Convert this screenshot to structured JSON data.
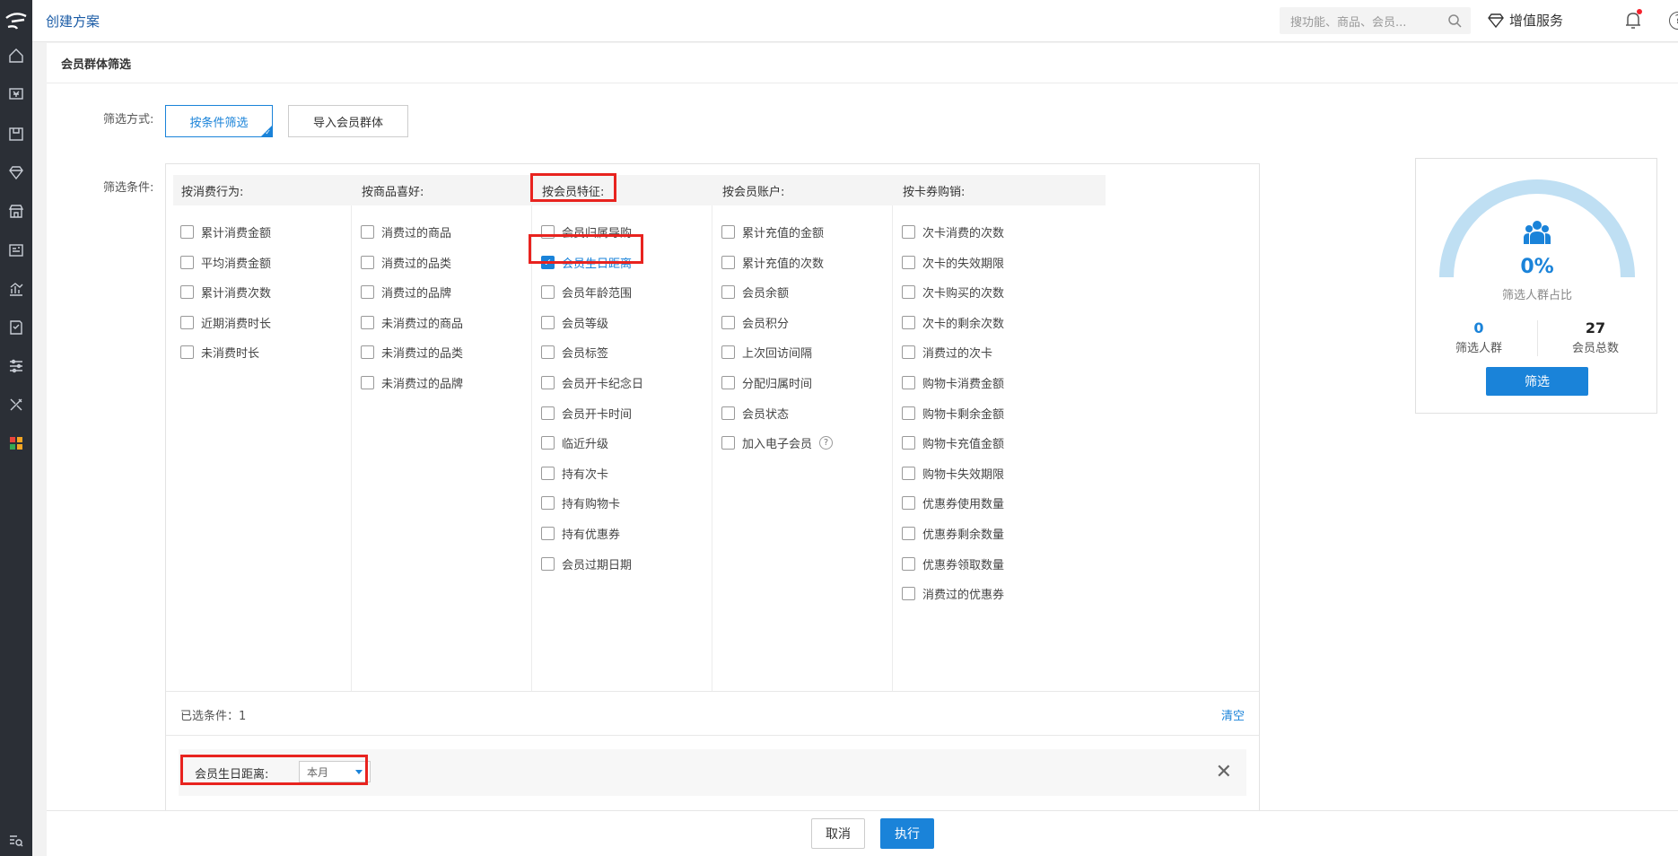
{
  "app": {
    "title": "创建方案"
  },
  "search": {
    "placeholder": "搜功能、商品、会员..."
  },
  "header": {
    "value_service": "增值服务"
  },
  "section": {
    "title": "会员群体筛选"
  },
  "filter_mode": {
    "label": "筛选方式:",
    "options": [
      "按条件筛选",
      "导入会员群体"
    ],
    "active": "按条件筛选"
  },
  "conditions": {
    "label": "筛选条件:",
    "columns": [
      {
        "title": "按消费行为:",
        "items": [
          "累计消费金额",
          "平均消费金额",
          "累计消费次数",
          "近期消费时长",
          "未消费时长"
        ]
      },
      {
        "title": "按商品喜好:",
        "items": [
          "消费过的商品",
          "消费过的品类",
          "消费过的品牌",
          "未消费过的商品",
          "未消费过的品类",
          "未消费过的品牌"
        ]
      },
      {
        "title": "按会员特征:",
        "items": [
          "会员归属导购",
          "会员生日距离",
          "会员年龄范围",
          "会员等级",
          "会员标签",
          "会员开卡纪念日",
          "会员开卡时间",
          "临近升级",
          "持有次卡",
          "持有购物卡",
          "持有优惠券",
          "会员过期日期"
        ]
      },
      {
        "title": "按会员账户:",
        "items": [
          "累计充值的金额",
          "累计充值的次数",
          "会员余额",
          "会员积分",
          "上次回访间隔",
          "分配归属时间",
          "会员状态",
          "加入电子会员"
        ]
      },
      {
        "title": "按卡券购销:",
        "items": [
          "次卡消费的次数",
          "次卡的失效期限",
          "次卡购买的次数",
          "次卡的剩余次数",
          "消费过的次卡",
          "购物卡消费金额",
          "购物卡剩余金额",
          "购物卡充值金额",
          "购物卡失效期限",
          "优惠券使用数量",
          "优惠券剩余数量",
          "优惠券领取数量",
          "消费过的优惠券"
        ]
      }
    ],
    "checked": "会员生日距离"
  },
  "selected": {
    "label": "已选条件：1",
    "clear": "清空"
  },
  "condition_row": {
    "label": "会员生日距离:",
    "value": "本月"
  },
  "stats": {
    "percent": "0%",
    "percent_label": "筛选人群占比",
    "filtered_count": "0",
    "filtered_label": "筛选人群",
    "total_count": "27",
    "total_label": "会员总数",
    "filter_button": "筛选",
    "ratio": 0
  },
  "footer": {
    "cancel": "取消",
    "execute": "执行"
  },
  "colors": {
    "accent": "#1a83d9",
    "highlight": "#e8231f",
    "sidebar": "#2b2f36"
  },
  "sidebar_icons": [
    "home-icon",
    "finance-icon",
    "goods-icon",
    "member-icon",
    "shop-icon",
    "card-icon",
    "report-icon",
    "doc-icon",
    "settings-icon",
    "tools-icon",
    "apps-icon",
    "search-list-icon"
  ]
}
